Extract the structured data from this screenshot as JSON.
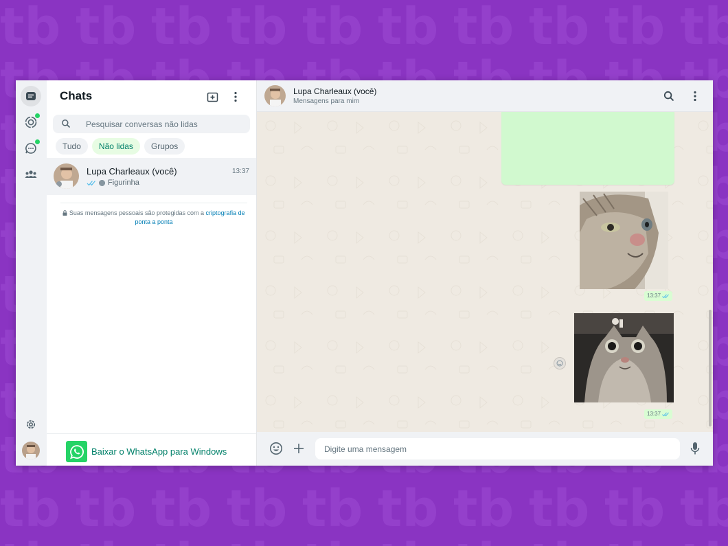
{
  "colors": {
    "background": "#8a34c2",
    "accent": "#008069",
    "whatsapp_green": "#25d366",
    "bubble_out": "#d9fdd3",
    "chat_wallpaper": "#efeae2"
  },
  "rail": {
    "items": [
      {
        "name": "chats-icon",
        "active": true,
        "badge": false
      },
      {
        "name": "status-icon",
        "active": false,
        "badge": true
      },
      {
        "name": "channels-icon",
        "active": false,
        "badge": true
      },
      {
        "name": "communities-icon",
        "active": false,
        "badge": false
      }
    ],
    "settings_icon": "gear-icon",
    "profile_icon": "avatar"
  },
  "list": {
    "title": "Chats",
    "new_chat_icon": "new-chat-icon",
    "menu_icon": "kebab-menu-icon",
    "search": {
      "placeholder": "Pesquisar conversas não lidas"
    },
    "filters": [
      {
        "label": "Tudo",
        "active": false
      },
      {
        "label": "Não lidas",
        "active": true
      },
      {
        "label": "Grupos",
        "active": false
      }
    ],
    "chats": [
      {
        "name": "Lupa Charleaux (você)",
        "time": "13:37",
        "preview": "Figurinha",
        "read": true
      }
    ],
    "encryption": {
      "text": "Suas mensagens pessoais são protegidas com a ",
      "link": "criptografia de ponta a ponta"
    },
    "download_label": "Baixar o WhatsApp para Windows"
  },
  "conversation": {
    "name": "Lupa Charleaux (você)",
    "subtitle": "Mensagens para mim",
    "search_icon": "search-icon",
    "menu_icon": "kebab-menu-icon",
    "messages": [
      {
        "type": "sticker",
        "time": "13:37",
        "read": true
      },
      {
        "type": "sticker",
        "time": "13:37",
        "read": true
      }
    ],
    "input": {
      "placeholder": "Digite uma mensagem"
    },
    "emoji_icon": "emoji-icon",
    "attach_icon": "plus-icon",
    "mic_icon": "microphone-icon"
  }
}
